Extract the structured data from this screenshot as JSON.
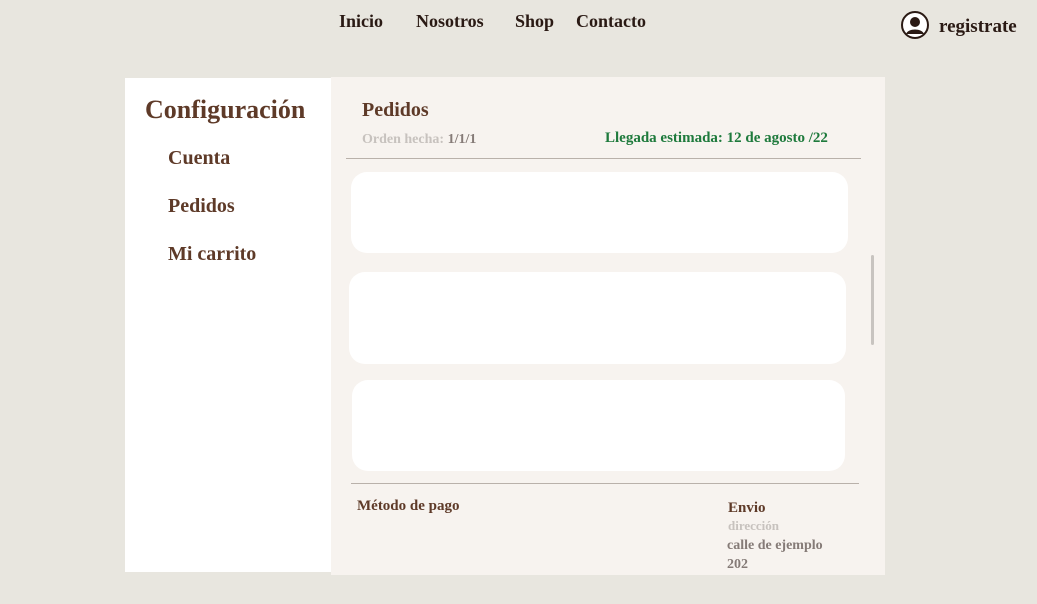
{
  "nav": {
    "items": [
      {
        "label": "Inicio"
      },
      {
        "label": "Nosotros"
      },
      {
        "label": "Shop"
      },
      {
        "label": "Contacto"
      }
    ]
  },
  "account": {
    "icon": "user-icon",
    "label": "registrate"
  },
  "sidebar": {
    "title": "Configuración",
    "items": [
      {
        "label": "Cuenta"
      },
      {
        "label": "Pedidos"
      },
      {
        "label": "Mi carrito"
      }
    ]
  },
  "orders": {
    "title": "Pedidos",
    "order_made_label": "Orden hecha:",
    "order_made_value": "1/1/1",
    "arrival": "Llegada estimada: 12 de agosto /22",
    "card_count": 3
  },
  "payment": {
    "label": "Método de pago"
  },
  "shipping": {
    "title": "Envio",
    "subtitle": "dirección",
    "street": "calle de ejemplo",
    "number": "202"
  },
  "colors": {
    "page_background": "#e8e6df",
    "panel_background": "#f7f3ef",
    "sidebar_background": "#ffffff",
    "brown_text": "#5e3a28",
    "dark_text": "#2a1a14",
    "muted_text": "#c7c2be",
    "grey_text": "#857b77",
    "arrival_green": "#1e7a3c"
  }
}
